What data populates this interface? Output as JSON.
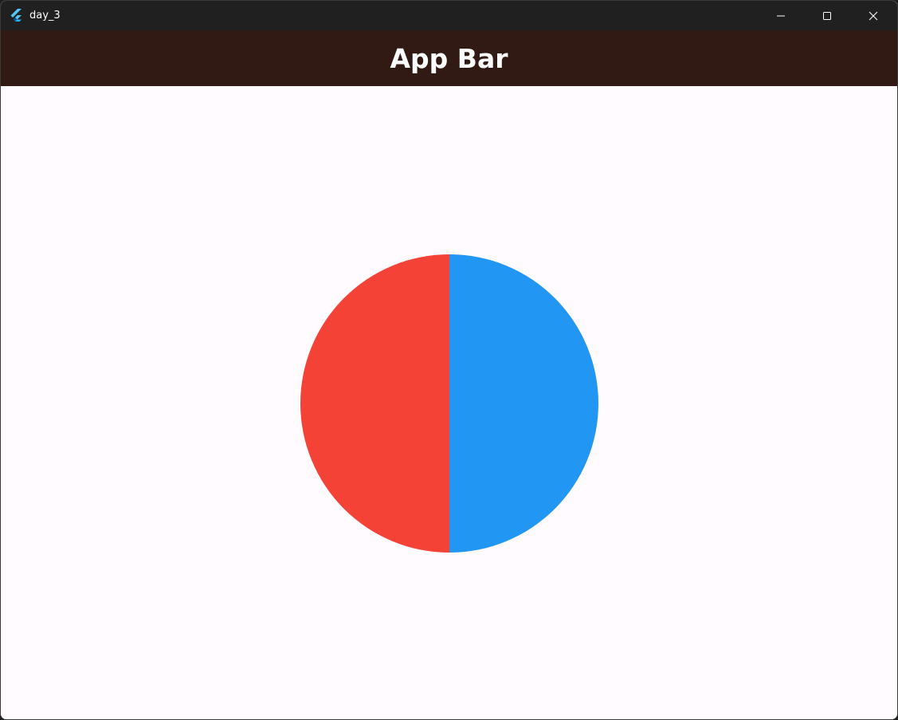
{
  "window": {
    "title": "day_3",
    "icon": "flutter-logo-icon",
    "controls": {
      "minimize_icon": "minimize-icon",
      "maximize_icon": "maximize-icon",
      "close_icon": "close-icon"
    }
  },
  "app_bar": {
    "title": "App Bar",
    "background": "#311a14",
    "title_color": "#ffffff"
  },
  "body": {
    "background": "#fffbfe"
  },
  "pie": {
    "left_half_color": "#f44336",
    "right_half_color": "#2196f3"
  }
}
